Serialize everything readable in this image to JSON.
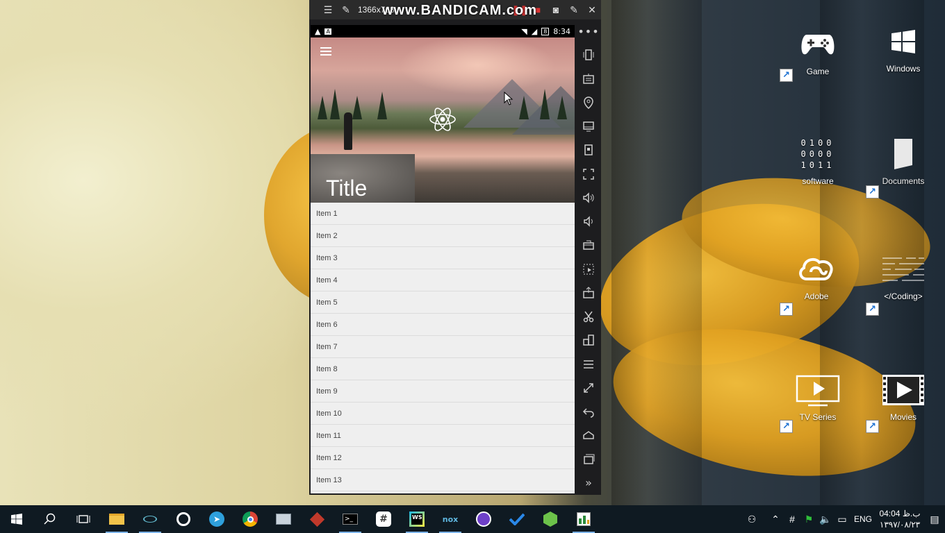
{
  "bandicam": {
    "resolution": "1366x768",
    "logo": "www.BANDICAM.com"
  },
  "desktop": {
    "icons": [
      {
        "label": "Game",
        "icon": "gamepad-icon"
      },
      {
        "label": "Windows",
        "icon": "windows-logo-icon"
      },
      {
        "label": "software",
        "icon": "binary-icon"
      },
      {
        "label": "Documents",
        "icon": "document-icon"
      },
      {
        "label": "Adobe",
        "icon": "creative-cloud-icon"
      },
      {
        "label": "</Coding>",
        "icon": "code-lines-icon"
      },
      {
        "label": "TV Series",
        "icon": "tv-play-icon"
      },
      {
        "label": "Movies",
        "icon": "film-play-icon"
      }
    ]
  },
  "phone": {
    "status": {
      "time": "8:34",
      "battery": "8"
    },
    "title": "Title",
    "items": [
      "Item 1",
      "Item 2",
      "Item 3",
      "Item 4",
      "Item 5",
      "Item 6",
      "Item 7",
      "Item 8",
      "Item 9",
      "Item 10",
      "Item 11",
      "Item 12",
      "Item 13"
    ]
  },
  "taskbar": {
    "lang": "ENG",
    "time": "04:04 ب.ظ",
    "date": "۱۳۹۷/۰۸/۲۳"
  }
}
